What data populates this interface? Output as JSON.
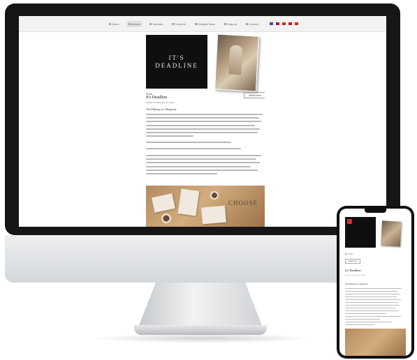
{
  "nav": {
    "items": [
      {
        "label": "Home",
        "icon": "home-icon"
      },
      {
        "label": "Articles",
        "icon": "document-icon"
      },
      {
        "label": "Tutorials",
        "icon": "book-icon"
      },
      {
        "label": "Products",
        "icon": "box-icon"
      },
      {
        "label": "Editorial Team",
        "icon": "people-icon"
      },
      {
        "label": "Support",
        "icon": "help-icon"
      },
      {
        "label": "Contact",
        "icon": "mail-icon"
      }
    ],
    "flag_colors": [
      "#3b4ea8",
      "#c8102e",
      "#d52b1e",
      "#ce1126",
      "#de2910"
    ]
  },
  "article": {
    "cover_line1": "IT'S",
    "cover_line2": "DEADLINE",
    "author_small": "Notes",
    "title": "It's Deadline",
    "meta": "Posted on February 22, 2018",
    "button_label": "Read more",
    "section_heading": "The Making of a Magazine",
    "photo_word": "CHOOSE"
  },
  "mobile": {
    "author_small": "By Notes",
    "button_label": "Read more",
    "title": "It's Deadline",
    "meta": "Posted on February 22, 2018",
    "section_heading": "The Making of a Magazine"
  },
  "colors": {
    "bezel": "#161616",
    "accent_red": "#d23030"
  }
}
